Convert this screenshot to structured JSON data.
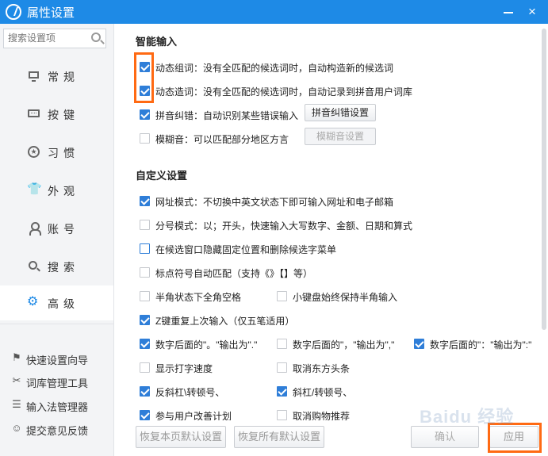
{
  "window": {
    "title": "属性设置",
    "close_glyph": "×"
  },
  "sidebar": {
    "search_placeholder": "搜索设置项",
    "items": [
      {
        "label": "常规",
        "icon": "monitor-icon"
      },
      {
        "label": "按键",
        "icon": "keyboard-icon"
      },
      {
        "label": "习惯",
        "icon": "star-icon"
      },
      {
        "label": "外观",
        "icon": "shirt-icon"
      },
      {
        "label": "账号",
        "icon": "user-icon"
      },
      {
        "label": "搜索",
        "icon": "search-icon"
      },
      {
        "label": "高级",
        "icon": "gear-icon",
        "active": true
      }
    ],
    "tools": [
      {
        "label": "快速设置向导",
        "icon": "flag-icon"
      },
      {
        "label": "词库管理工具",
        "icon": "tools-icon"
      },
      {
        "label": "输入法管理器",
        "icon": "list-icon"
      },
      {
        "label": "提交意见反馈",
        "icon": "feedback-icon"
      }
    ]
  },
  "smart_input": {
    "title": "智能输入",
    "options": [
      {
        "label": "动态组词：没有全匹配的候选词时，自动构造新的候选词",
        "checked": true
      },
      {
        "label": "动态造词：没有全匹配的候选词时，自动记录到拼音用户词库",
        "checked": true
      },
      {
        "label": "拼音纠错：自动识别某些错误输入",
        "checked": true
      },
      {
        "label": "模糊音：可以匹配部分地区方言",
        "checked": false
      }
    ],
    "pinyin_fix_button": "拼音纠错设置",
    "fuzzy_button": "模糊音设置"
  },
  "custom": {
    "title": "自定义设置",
    "options": [
      {
        "label": "网址模式：不切换中英文状态下即可输入网址和电子邮箱",
        "checked": true
      },
      {
        "label": "分号模式：以；开头，快速输入大写数字、金额、日期和算式",
        "checked": false
      },
      {
        "label": "在候选窗口隐藏固定位置和删除候选字菜单",
        "checked": false
      },
      {
        "label": "标点符号自动匹配（支持《》【】等）",
        "checked": false
      },
      {
        "label": "半角状态下全角空格",
        "checked": false
      },
      {
        "label": "小键盘始终保持半角输入",
        "checked": false
      },
      {
        "label": "Z键重复上次输入（仅五笔适用）",
        "checked": true
      },
      {
        "label": "数字后面的\"。\"输出为\".\"",
        "checked": true
      },
      {
        "label": "数字后面的\"，\"输出为\",\"",
        "checked": false
      },
      {
        "label": "数字后面的\"：\"输出为\":\"",
        "checked": true
      },
      {
        "label": "显示打字速度",
        "checked": false
      },
      {
        "label": "取消东方头条",
        "checked": false
      },
      {
        "label": "反斜杠\\转顿号、",
        "checked": true
      },
      {
        "label": "斜杠/转顿号、",
        "checked": true
      },
      {
        "label": "参与用户改善计划",
        "checked": true
      },
      {
        "label": "取消购物推荐",
        "checked": false
      }
    ]
  },
  "footer": {
    "restore_page": "恢复本页默认设置",
    "restore_all": "恢复所有默认设置",
    "confirm": "确认",
    "apply": "应用"
  },
  "watermark": "Baidu 经验",
  "colors": {
    "titlebar": "#1e8ae6",
    "checkbox": "#2f7ed8",
    "highlight": "#ff6a13"
  }
}
